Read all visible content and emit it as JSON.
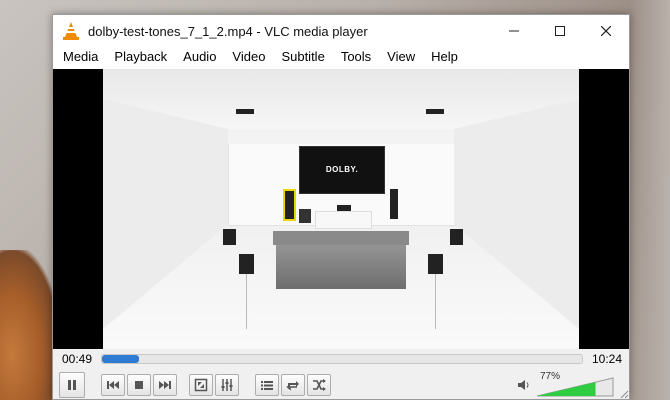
{
  "window": {
    "title": "dolby-test-tones_7_1_2.mp4 - VLC media player",
    "icons": [
      "vlc-cone-icon",
      "minimize-icon",
      "maximize-icon",
      "close-icon"
    ]
  },
  "menu": {
    "items": [
      "Media",
      "Playback",
      "Audio",
      "Video",
      "Subtitle",
      "Tools",
      "View",
      "Help"
    ]
  },
  "video": {
    "logo_text": "DOLBY."
  },
  "playback": {
    "elapsed": "00:49",
    "total": "10:24",
    "progress_fraction": 0.078
  },
  "volume": {
    "percent_label": "77%",
    "level_fraction": 0.77,
    "accent": "#2ecc40"
  },
  "colors": {
    "seek_fill": "#2f7bd3",
    "vlc_orange": "#f08a00"
  }
}
